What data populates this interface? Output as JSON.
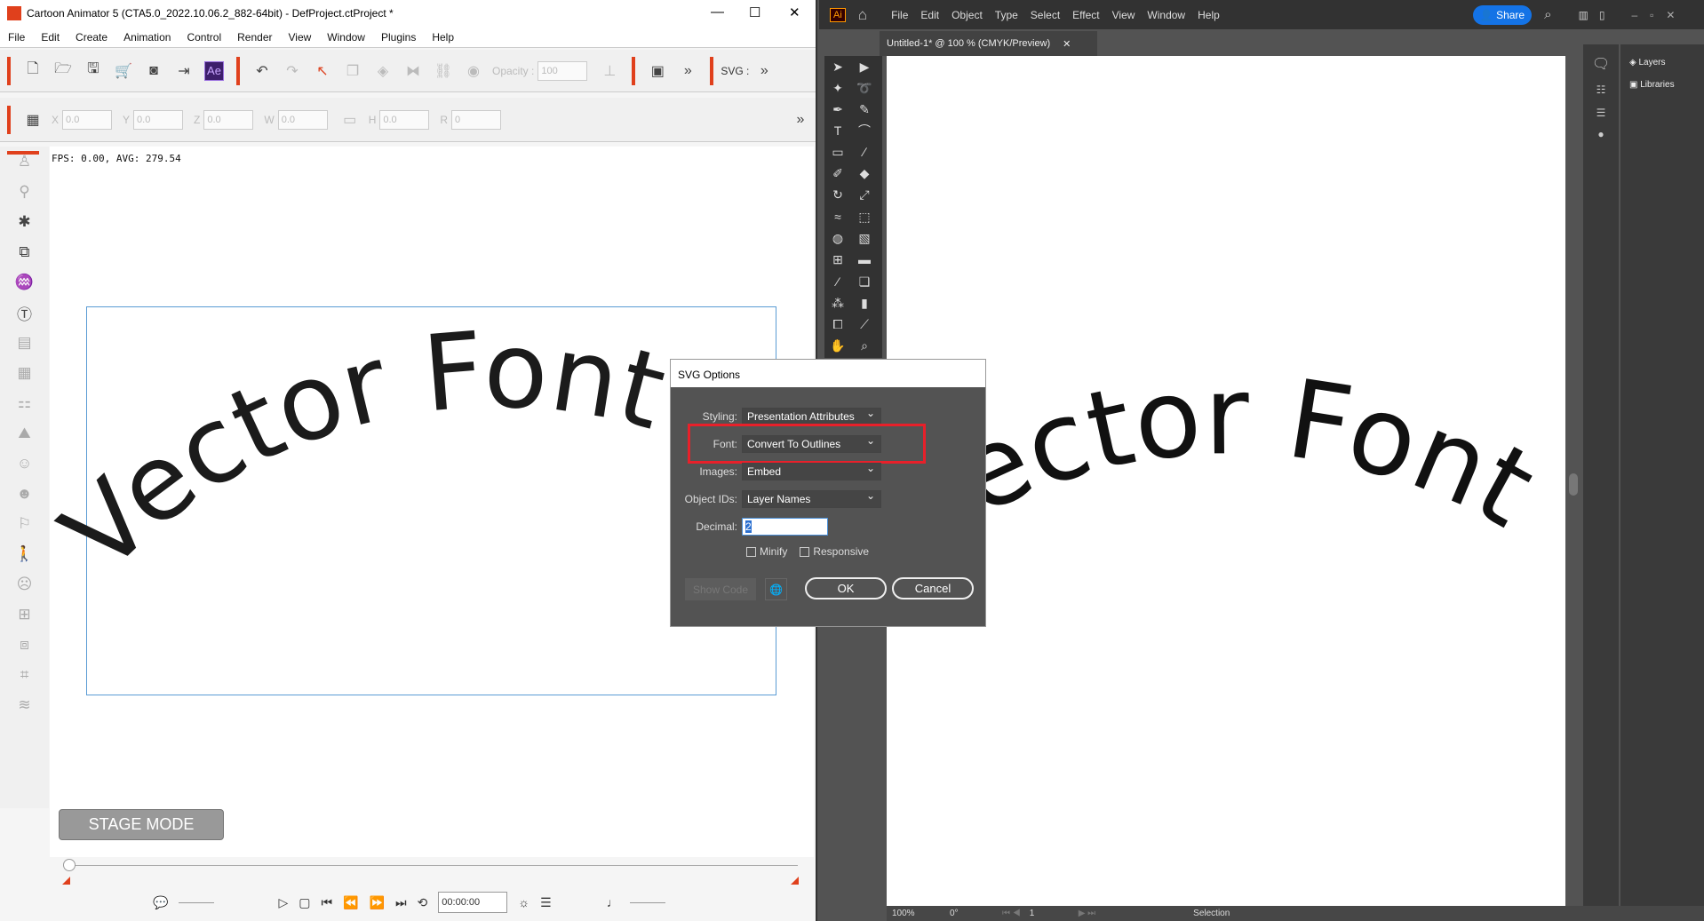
{
  "ca": {
    "title": "Cartoon Animator 5  (CTA5.0_2022.10.06.2_882-64bit) - DefProject.ctProject *",
    "menu": [
      "File",
      "Edit",
      "Create",
      "Animation",
      "Control",
      "Render",
      "View",
      "Window",
      "Plugins",
      "Help"
    ],
    "toolbar": {
      "ae_label": "Ae",
      "opacity_label": "Opacity :",
      "opacity_value": "100",
      "svg_label": "SVG :"
    },
    "transform": {
      "x_label": "X",
      "x": "0.0",
      "y_label": "Y",
      "y": "0.0",
      "z_label": "Z",
      "z": "0.0",
      "w_label": "W",
      "w": "0.0",
      "h_label": "H",
      "h": "0.0",
      "r_label": "R",
      "r": "0"
    },
    "fps": "FPS: 0.00, AVG: 279.54",
    "stage_text": "Vector Font",
    "stage_mode": "STAGE MODE",
    "timecode": "00:00:00",
    "accent": "#e0401c"
  },
  "ai": {
    "logo": "Ai",
    "menu": [
      "File",
      "Edit",
      "Object",
      "Type",
      "Select",
      "Effect",
      "View",
      "Window",
      "Help"
    ],
    "share": "Share",
    "tab": "Untitled-1* @ 100 % (CMYK/Preview)",
    "canvas_text": "Vector Font",
    "panels": [
      "Layers",
      "Libraries"
    ],
    "status": {
      "zoom": "100%",
      "rotation": "0°",
      "artboard": "1",
      "tool": "Selection"
    },
    "share_color": "#1473e6"
  },
  "dialog": {
    "title": "SVG Options",
    "styling_label": "Styling:",
    "styling": "Presentation Attributes",
    "font_label": "Font:",
    "font": "Convert To Outlines",
    "images_label": "Images:",
    "images": "Embed",
    "ids_label": "Object IDs:",
    "ids": "Layer Names",
    "decimal_label": "Decimal:",
    "decimal": "2",
    "minify": "Minify",
    "minify_checked": false,
    "responsive": "Responsive",
    "responsive_checked": false,
    "show_code": "Show Code",
    "ok": "OK",
    "cancel": "Cancel",
    "highlight_color": "#e8202a"
  }
}
